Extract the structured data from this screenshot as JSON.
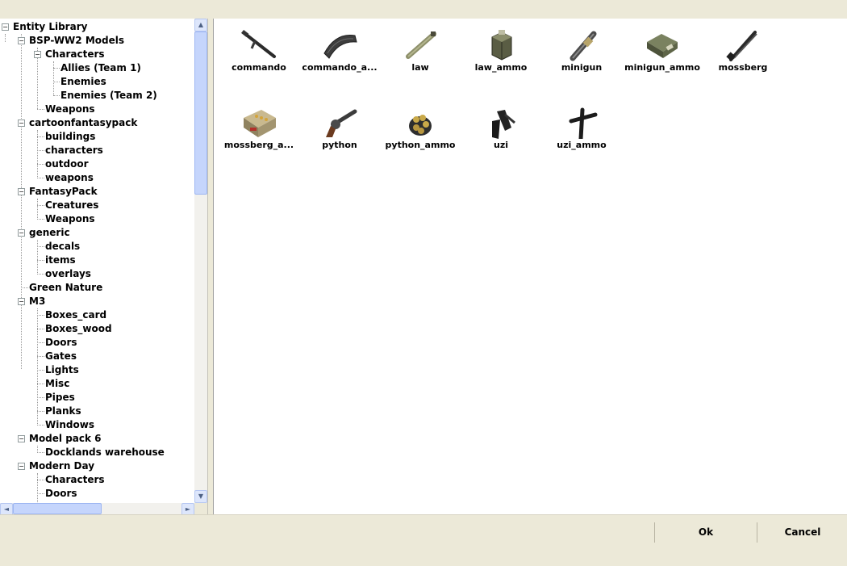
{
  "tree": {
    "items": [
      {
        "label": "Entity Library"
      },
      {
        "label": "BSP-WW2 Models"
      },
      {
        "label": "Characters"
      },
      {
        "label": "Allies (Team 1)"
      },
      {
        "label": "Enemies"
      },
      {
        "label": "Enemies (Team 2)"
      },
      {
        "label": "Weapons"
      },
      {
        "label": "cartoonfantasypack"
      },
      {
        "label": "buildings"
      },
      {
        "label": "characters"
      },
      {
        "label": "outdoor"
      },
      {
        "label": "weapons"
      },
      {
        "label": "FantasyPack"
      },
      {
        "label": "Creatures"
      },
      {
        "label": "Weapons"
      },
      {
        "label": "generic"
      },
      {
        "label": "decals"
      },
      {
        "label": "items"
      },
      {
        "label": "overlays"
      },
      {
        "label": "Green Nature"
      },
      {
        "label": "M3"
      },
      {
        "label": "Boxes_card"
      },
      {
        "label": "Boxes_wood"
      },
      {
        "label": "Doors"
      },
      {
        "label": "Gates"
      },
      {
        "label": "Lights"
      },
      {
        "label": "Misc"
      },
      {
        "label": "Pipes"
      },
      {
        "label": "Planks"
      },
      {
        "label": "Windows"
      },
      {
        "label": "Model pack 6"
      },
      {
        "label": "Docklands warehouse"
      },
      {
        "label": "Modern Day"
      },
      {
        "label": "Characters"
      },
      {
        "label": "Doors"
      }
    ],
    "expander_symbol": "−"
  },
  "entities": [
    {
      "label": "commando",
      "icon": "rifle-icon"
    },
    {
      "label": "commando_a...",
      "icon": "magazine-icon"
    },
    {
      "label": "law",
      "icon": "rocket-launcher-icon"
    },
    {
      "label": "law_ammo",
      "icon": "ammo-crate-icon"
    },
    {
      "label": "minigun",
      "icon": "minigun-icon"
    },
    {
      "label": "minigun_ammo",
      "icon": "ammo-box-icon"
    },
    {
      "label": "mossberg",
      "icon": "shotgun-icon"
    },
    {
      "label": "mossberg_a...",
      "icon": "shell-box-icon"
    },
    {
      "label": "python",
      "icon": "revolver-icon"
    },
    {
      "label": "python_ammo",
      "icon": "bullets-icon"
    },
    {
      "label": "uzi",
      "icon": "smg-icon"
    },
    {
      "label": "uzi_ammo",
      "icon": "smg-magazine-icon"
    }
  ],
  "buttons": {
    "ok": "Ok",
    "cancel": "Cancel"
  },
  "scroll_arrows": {
    "up": "▲",
    "down": "▼",
    "left": "◄",
    "right": "►"
  }
}
